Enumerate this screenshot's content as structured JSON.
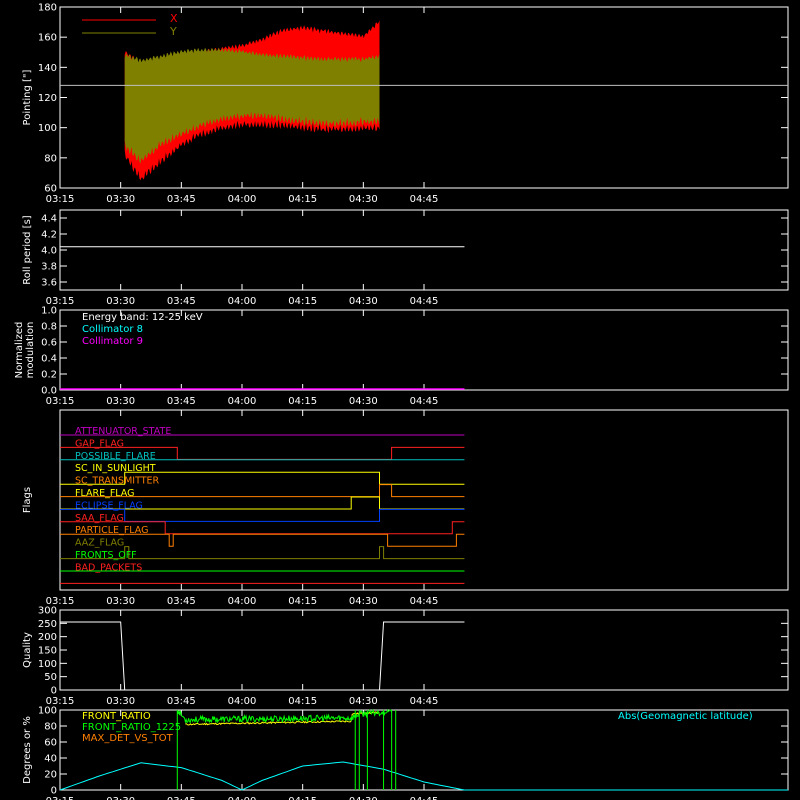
{
  "chart_data": [
    {
      "type": "area",
      "ylabel": "Pointing [\"]",
      "ylim": [
        60,
        180
      ],
      "yticks": [
        60,
        80,
        100,
        120,
        140,
        160,
        180
      ],
      "x_ticks": [
        "03:15",
        "03:30",
        "03:45",
        "04:00",
        "04:15",
        "04:30",
        "04:45"
      ],
      "reference_line": 128,
      "legend": [
        "X",
        "Y"
      ],
      "colors": {
        "X": "#ff0000",
        "Y": "#808000",
        "ref": "#c0c0c0"
      },
      "x_range": [
        "03:15",
        "04:55"
      ],
      "data_range": [
        "03:31",
        "04:34"
      ],
      "series": [
        {
          "name": "X",
          "x": [
            "03:31",
            "03:35",
            "03:40",
            "03:45",
            "03:50",
            "03:55",
            "04:00",
            "04:05",
            "04:10",
            "04:15",
            "04:20",
            "04:25",
            "04:30",
            "04:34"
          ],
          "low": [
            86,
            70,
            82,
            93,
            100,
            104,
            106,
            106,
            106,
            104,
            103,
            103,
            104,
            104
          ],
          "high": [
            148,
            140,
            143,
            146,
            148,
            150,
            152,
            156,
            162,
            164,
            162,
            160,
            158,
            168
          ]
        },
        {
          "name": "Y",
          "x": [
            "03:31",
            "03:35",
            "03:40",
            "03:45",
            "03:50",
            "03:55",
            "04:00",
            "04:05",
            "04:10",
            "04:15",
            "04:20",
            "04:25",
            "04:30",
            "04:34"
          ],
          "low": [
            92,
            82,
            93,
            100,
            106,
            110,
            112,
            112,
            110,
            108,
            107,
            107,
            108,
            108
          ],
          "high": [
            146,
            142,
            145,
            148,
            149,
            149,
            148,
            146,
            145,
            144,
            143,
            143,
            143,
            145
          ]
        }
      ]
    },
    {
      "type": "line",
      "ylabel": "Roll period [s]",
      "ylim": [
        3.5,
        4.5
      ],
      "yticks": [
        3.6,
        3.8,
        4.0,
        4.2,
        4.4
      ],
      "x_ticks": [
        "03:15",
        "03:30",
        "03:45",
        "04:00",
        "04:15",
        "04:30",
        "04:45"
      ],
      "series": [
        {
          "x": [
            "03:15",
            "04:55"
          ],
          "values": [
            4.04,
            4.04
          ]
        }
      ]
    },
    {
      "type": "line",
      "ylabel_lines": [
        "Normalized",
        "modulation"
      ],
      "ylim": [
        0,
        1
      ],
      "yticks": [
        0.0,
        0.2,
        0.4,
        0.6,
        0.8,
        1.0
      ],
      "x_ticks": [
        "03:15",
        "03:30",
        "03:45",
        "04:00",
        "04:15",
        "04:30",
        "04:45"
      ],
      "legend": [
        "Energy band: 12-25 keV",
        "Collimator 8",
        "Collimator 9"
      ],
      "colors": [
        "#ffffff",
        "#00ffff",
        "#ff00ff"
      ],
      "series": [
        {
          "name": "Collimator 9",
          "x": [
            "03:15",
            "04:55"
          ],
          "values": [
            0,
            0
          ]
        }
      ]
    },
    {
      "type": "line",
      "ylabel": "Flags",
      "x_ticks": [
        "03:15",
        "03:30",
        "03:45",
        "04:00",
        "04:15",
        "04:30",
        "04:45"
      ],
      "flags": [
        {
          "name": "ATTENUATOR_STATE",
          "color": "#c000c0",
          "segments": [
            [
              "03:15",
              "04:55",
              0
            ]
          ]
        },
        {
          "name": "GAP_FLAG",
          "color": "#ff2020",
          "segments": [
            [
              "03:15",
              "03:44",
              0
            ],
            [
              "03:44",
              "04:37",
              -1
            ],
            [
              "04:37",
              "04:55",
              0
            ]
          ]
        },
        {
          "name": "POSSIBLE_FLARE",
          "color": "#00c0c0",
          "segments": [
            [
              "03:15",
              "04:55",
              0
            ]
          ]
        },
        {
          "name": "SC_IN_SUNLIGHT",
          "color": "#ffff00",
          "segments": [
            [
              "03:15",
              "03:31",
              -1
            ],
            [
              "03:31",
              "04:34",
              0
            ],
            [
              "04:34",
              "04:55",
              -1
            ]
          ]
        },
        {
          "name": "SC_TRANSMITTER",
          "color": "#ff8000",
          "segments": [
            [
              "03:15",
              "04:34",
              -1
            ],
            [
              "04:34",
              "04:37",
              0
            ],
            [
              "04:37",
              "04:55",
              -1
            ]
          ]
        },
        {
          "name": "FLARE_FLAG",
          "color": "#ffff00",
          "segments": [
            [
              "03:15",
              "04:27",
              -1
            ],
            [
              "04:27",
              "04:34",
              0
            ],
            [
              "04:34",
              "04:55",
              -1
            ]
          ]
        },
        {
          "name": "ECLIPSE_FLAG",
          "color": "#0040ff",
          "segments": [
            [
              "03:15",
              "03:31",
              0
            ],
            [
              "03:31",
              "04:34",
              -1
            ],
            [
              "04:34",
              "04:55",
              0
            ]
          ]
        },
        {
          "name": "SAA_FLAG",
          "color": "#ff2020",
          "segments": [
            [
              "03:15",
              "03:41",
              0
            ],
            [
              "03:41",
              "04:52",
              -1
            ],
            [
              "04:52",
              "04:55",
              0
            ]
          ]
        },
        {
          "name": "PARTICLE_FLAG",
          "color": "#ff8000",
          "segments": [
            [
              "03:15",
              "03:42",
              0
            ],
            [
              "03:42",
              "03:43",
              -1
            ],
            [
              "03:43",
              "04:36",
              0
            ],
            [
              "04:36",
              "04:37",
              -1
            ],
            [
              "04:37",
              "04:53",
              -1
            ],
            [
              "04:53",
              "04:55",
              0
            ]
          ]
        },
        {
          "name": "AAZ_FLAG",
          "color": "#808000",
          "segments": [
            [
              "03:15",
              "03:31",
              -1
            ],
            [
              "03:31",
              "03:32",
              0
            ],
            [
              "03:32",
              "04:34",
              -1
            ],
            [
              "04:34",
              "04:35",
              0
            ],
            [
              "04:35",
              "04:55",
              -1
            ]
          ]
        },
        {
          "name": "FRONTS_OFF",
          "color": "#00ff00",
          "segments": [
            [
              "03:15",
              "04:55",
              -1
            ]
          ]
        },
        {
          "name": "BAD_PACKETS",
          "color": "#ff2020",
          "segments": [
            [
              "03:15",
              "04:55",
              -1
            ]
          ]
        }
      ]
    },
    {
      "type": "line",
      "ylabel": "Quality",
      "ylim": [
        0,
        300
      ],
      "yticks": [
        0,
        50,
        100,
        150,
        200,
        250,
        300
      ],
      "x_ticks": [
        "03:15",
        "03:30",
        "03:45",
        "04:00",
        "04:15",
        "04:30",
        "04:45"
      ],
      "series": [
        {
          "x": [
            "03:15",
            "03:30",
            "03:31",
            "04:34",
            "04:35",
            "04:55"
          ],
          "values": [
            255,
            255,
            0,
            0,
            255,
            255
          ]
        }
      ]
    },
    {
      "type": "line",
      "ylabel": "Degrees or %",
      "ylim": [
        0,
        100
      ],
      "yticks": [
        0,
        20,
        40,
        60,
        80,
        100
      ],
      "x_ticks": [
        "03:15",
        "03:30",
        "03:45",
        "04:00",
        "04:15",
        "04:30",
        "04:45"
      ],
      "legend": [
        "FRONT_RATIO",
        "FRONT_RATIO_1225",
        "MAX_DET_VS_TOT"
      ],
      "legend_colors": [
        "#ffff00",
        "#00ff00",
        "#ff8000"
      ],
      "annotation": "Abs(Geomagnetic latitude)",
      "annotation_color": "#00ffff",
      "series": [
        {
          "name": "Abs(Geomagnetic latitude)",
          "color": "#00ffff",
          "x": [
            "03:15",
            "03:25",
            "03:35",
            "03:45",
            "03:55",
            "04:00",
            "04:05",
            "04:15",
            "04:25",
            "04:35",
            "04:45",
            "04:55"
          ],
          "values": [
            0,
            18,
            34,
            28,
            12,
            0,
            12,
            30,
            35,
            26,
            10,
            0
          ]
        },
        {
          "name": "FRONT_RATIO",
          "color": "#ffff00",
          "x": [
            "03:46",
            "04:27",
            "04:27",
            "04:34"
          ],
          "values": [
            82,
            86,
            95,
            97
          ]
        },
        {
          "name": "FRONT_RATIO_1225",
          "color": "#00ff00",
          "x": [
            "03:44",
            "03:46",
            "04:27",
            "04:29",
            "04:34",
            "04:37"
          ],
          "values": [
            100,
            88,
            90,
            95,
            97,
            100
          ]
        }
      ]
    }
  ]
}
